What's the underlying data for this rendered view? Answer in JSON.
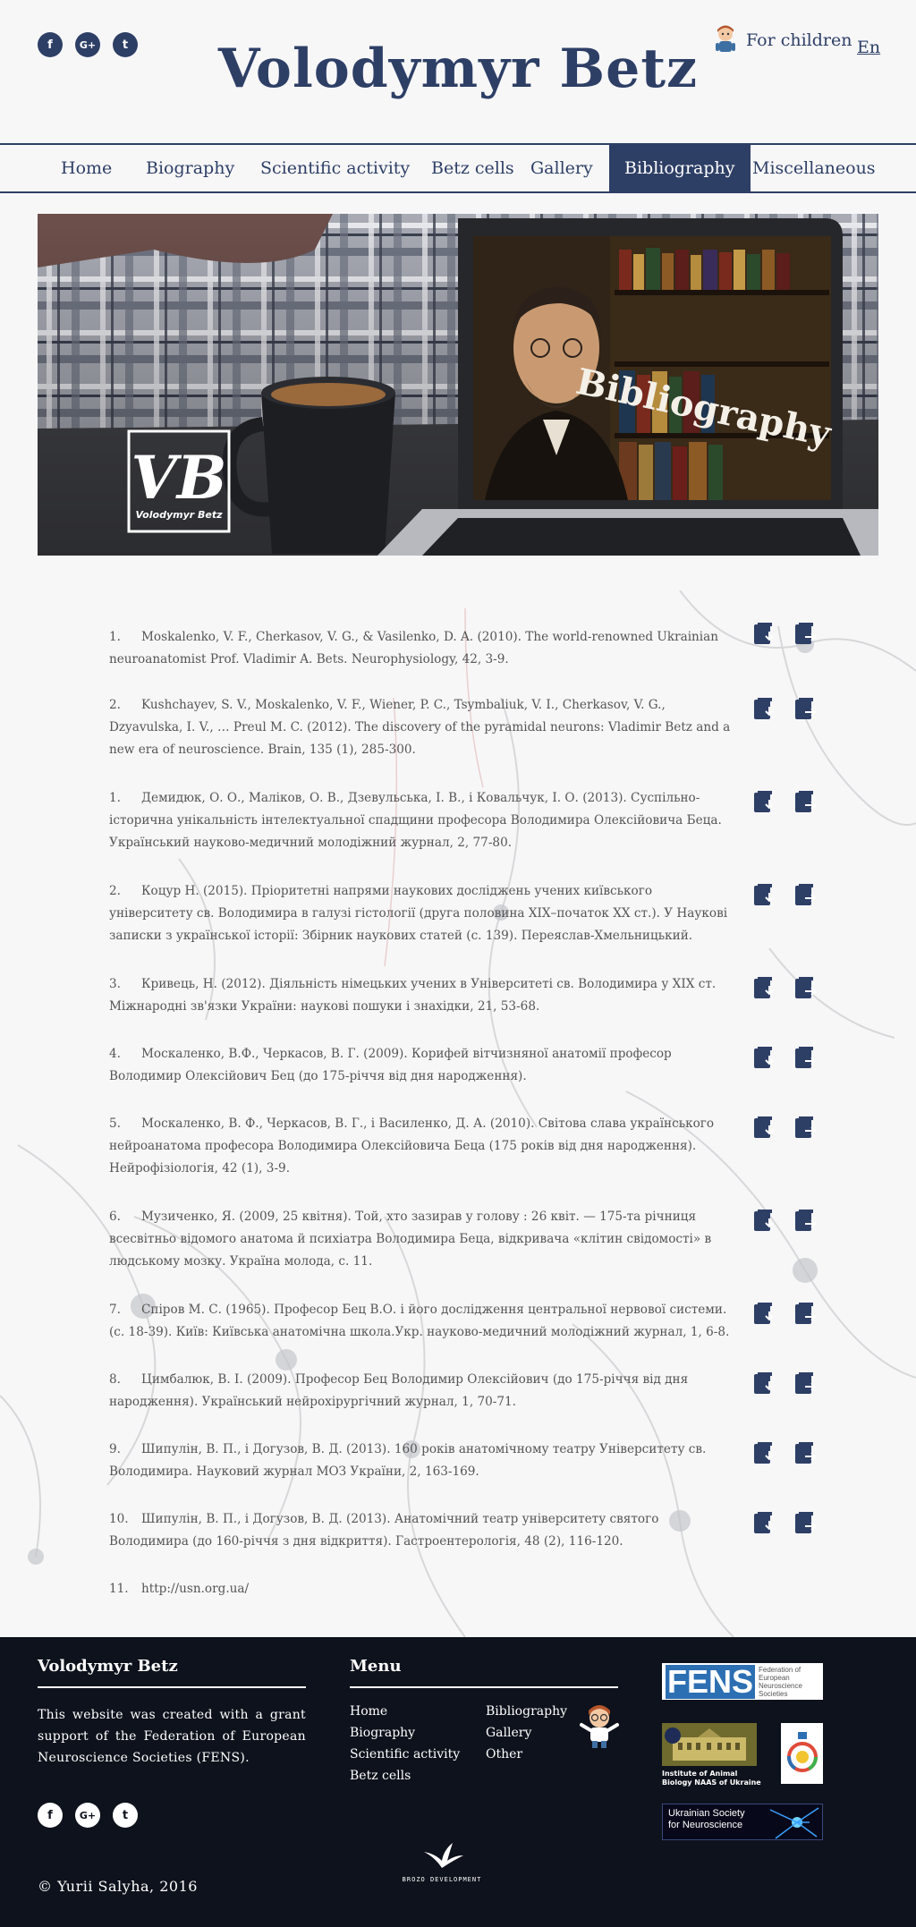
{
  "header": {
    "site_title": "Volodymyr Betz",
    "social": [
      "f",
      "G+",
      "t"
    ],
    "for_children": "For children",
    "language": "En"
  },
  "nav": {
    "items": [
      "Home",
      "Biography",
      "Scientific activity",
      "Betz cells",
      "Gallery",
      "Bibliography",
      "Miscellaneous"
    ],
    "active": "Bibliography"
  },
  "hero": {
    "title": "Bibliography",
    "logo_letters": "VB",
    "logo_caption": "Volodymyr Betz"
  },
  "bibliography": [
    {
      "num": "1.",
      "text": "Moskalenko, V. F., Cherkasov, V. G., & Vasilenko, D. A. (2010). The world-renowned Ukrainian neuroanatomist Prof. Vladimir A. Bets. Neurophysiology, 42, 3-9."
    },
    {
      "num": "2.",
      "text": "Kushchayev, S. V., Moskalenko, V. F., Wiener, P. C., Tsymbaliuk, V. I., Cherkasov, V. G., Dzyavulska, I. V., … Preul M. C. (2012). The discovery of the pyramidal neurons: Vladimir Betz and a new era of neuroscience. Brain, 135 (1), 285-300."
    },
    {
      "num": "1.",
      "text": "Демидюк, О. О., Маліков, О. В., Дзевульська, І. В., і Ковальчук, І. О. (2013). Суспільно-історична унікальність інтелектуальної спадщини професора Володимира Олексійовича Беца. Український науково-медичний молодіжний журнал, 2, 77-80."
    },
    {
      "num": "2.",
      "text": "Коцур Н. (2015). Пріоритетні напрями наукових досліджень учених київського університету св. Володимира в галузі гістології (друга половина ХІХ–початок ХХ ст.). У Наукові записки з української історії: Збірник наукових статей (с. 139). Переяслав-Хмельницький."
    },
    {
      "num": "3.",
      "text": "Кривець, Н. (2012). Діяльність німецьких учених в Університеті св. Володимира у ХІХ ст. Міжнародні зв'язки України: наукові пошуки і знахідки, 21, 53-68."
    },
    {
      "num": "4.",
      "text": "Москаленко, В.Ф., Черкасов, В. Г. (2009). Корифей  вітчизняної анатомії професор Володимир Олексійович Бец (до 175-річчя від дня народження)."
    },
    {
      "num": "5.",
      "text": "Москаленко, В. Ф., Черкасов, В. Г., і Василенко, Д. А. (2010). Світова слава українського нейроанатома професора Володимира Олексійовича Беца (175 років від дня народження). Нейрофізіологія, 42 (1), 3-9."
    },
    {
      "num": "6.",
      "text": "Музиченко, Я. (2009, 25 квітня). Той, хто зазирав у голову : 26 квіт. — 175-та річниця всесвітньо відомого анатома й психіатра Володимира Беца, відкривача «клітин свідомості» в людському мозку. Україна молода, с. 11."
    },
    {
      "num": "7.",
      "text": "Спіров М. С. (1965). Професор Бец В.О. і його дослідження центральної нервової системи. (с. 18-39). Київ: Київська анатомічна школа.Укр. науково-медичний молодіжний журнал, 1, 6-8."
    },
    {
      "num": "8.",
      "text": "Цимбалюк, В. І. (2009). Професор Бец Володимир Олексійович (до 175-річчя від дня народження). Український нейрохірургічний журнал, 1, 70-71."
    },
    {
      "num": "9.",
      "text": "Шипулін, В. П., і Догузов, В. Д. (2013). 160 років анатомічному театру Університету св. Володимира. Науковий журнал МОЗ України, 2, 163-169."
    },
    {
      "num": "10.",
      "text": "Шипулін, В. П., і Догузов, В. Д. (2013). Анатомічний театр університету святого Володимира (до 160-річчя з дня відкриття). Гастроентерологія, 48 (2), 116-120."
    },
    {
      "num": "11.",
      "text": "http://usn.org.ua/"
    }
  ],
  "footer": {
    "about_title": "Volodymyr Betz",
    "about_text": "This website was created with a grant support of the Federation of European Neuroscience Societies (FENS).",
    "menu_title": "Menu",
    "menu_col1": [
      "Home",
      "Biography",
      "Scientific activity",
      "Betz cells"
    ],
    "menu_col2": [
      "Bibliography",
      "Gallery",
      "Other"
    ],
    "copyright": "© Yurii Salyha, 2016",
    "developer": "BROZO DEVELOPMENT",
    "partners": {
      "fens_abbr": "FENS",
      "fens_name": [
        "Federation of",
        "European",
        "Neuroscience",
        "Societies"
      ],
      "institute": [
        "Institute of Animal",
        "Biology NAAS of Ukraine"
      ],
      "usn": [
        "Ukrainian Society",
        "for Neuroscience"
      ]
    }
  },
  "colors": {
    "primary": "#2e3f66",
    "background": "#f7f7f8",
    "footer": "#0d121c"
  },
  "icons": {
    "download": "download-document-icon",
    "open": "open-document-icon"
  }
}
